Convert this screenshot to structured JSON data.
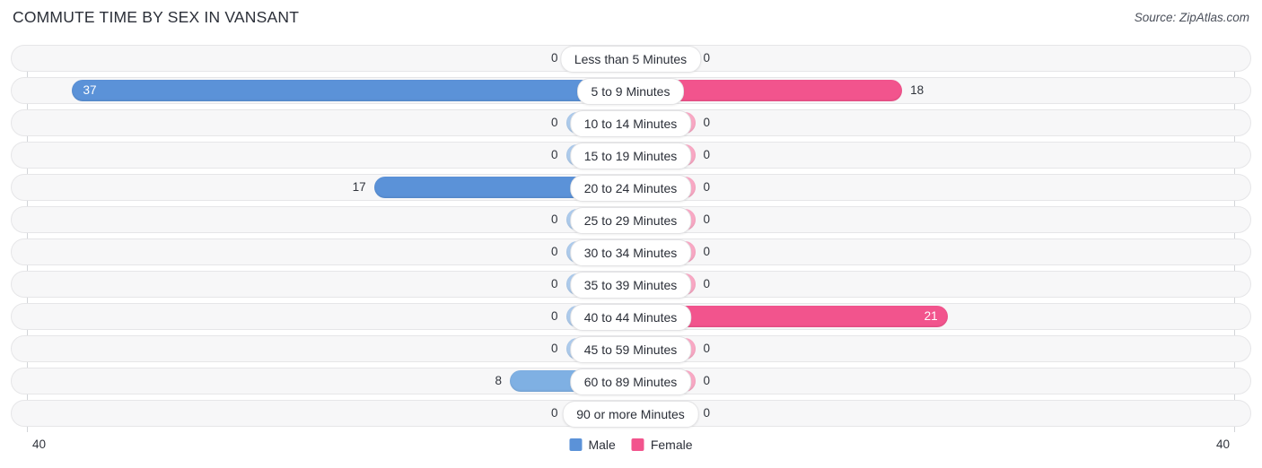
{
  "header": {
    "title": "COMMUTE TIME BY SEX IN VANSANT",
    "source": "Source: ZipAtlas.com"
  },
  "axis": {
    "left_tick": "40",
    "right_tick": "40"
  },
  "legend": {
    "items": [
      {
        "label": "Male",
        "color": "#5b92d8"
      },
      {
        "label": "Female",
        "color": "#f2548d"
      }
    ]
  },
  "colors": {
    "male_strong": "#5b92d8",
    "male_mid": "#7fb0e3",
    "male_light": "#adcbec",
    "female_strong": "#f2548d",
    "female_mid": "#f77aa8",
    "female_light": "#f9a8c4",
    "track": "#f7f7f8",
    "track_border": "#e6e6e8"
  },
  "chart_data": {
    "type": "bar",
    "orientation": "horizontal-diverging",
    "title": "COMMUTE TIME BY SEX IN VANSANT",
    "xlabel": "",
    "ylabel": "",
    "xlim": [
      40,
      40
    ],
    "axis_max": 40,
    "grid": false,
    "legend_position": "bottom-center",
    "categories": [
      "Less than 5 Minutes",
      "5 to 9 Minutes",
      "10 to 14 Minutes",
      "15 to 19 Minutes",
      "20 to 24 Minutes",
      "25 to 29 Minutes",
      "30 to 34 Minutes",
      "35 to 39 Minutes",
      "40 to 44 Minutes",
      "45 to 59 Minutes",
      "60 to 89 Minutes",
      "90 or more Minutes"
    ],
    "series": [
      {
        "name": "Male",
        "values": [
          0,
          37,
          0,
          0,
          17,
          0,
          0,
          0,
          0,
          0,
          8,
          0
        ]
      },
      {
        "name": "Female",
        "values": [
          0,
          18,
          0,
          0,
          0,
          0,
          0,
          0,
          21,
          0,
          0,
          0
        ]
      }
    ]
  },
  "rows": [
    {
      "label": "Less than 5 Minutes",
      "male": "0",
      "female": "0"
    },
    {
      "label": "5 to 9 Minutes",
      "male": "37",
      "female": "18"
    },
    {
      "label": "10 to 14 Minutes",
      "male": "0",
      "female": "0"
    },
    {
      "label": "15 to 19 Minutes",
      "male": "0",
      "female": "0"
    },
    {
      "label": "20 to 24 Minutes",
      "male": "17",
      "female": "0"
    },
    {
      "label": "25 to 29 Minutes",
      "male": "0",
      "female": "0"
    },
    {
      "label": "30 to 34 Minutes",
      "male": "0",
      "female": "0"
    },
    {
      "label": "35 to 39 Minutes",
      "male": "0",
      "female": "0"
    },
    {
      "label": "40 to 44 Minutes",
      "male": "0",
      "female": "21"
    },
    {
      "label": "45 to 59 Minutes",
      "male": "0",
      "female": "0"
    },
    {
      "label": "60 to 89 Minutes",
      "male": "8",
      "female": "0"
    },
    {
      "label": "90 or more Minutes",
      "male": "0",
      "female": "0"
    }
  ]
}
